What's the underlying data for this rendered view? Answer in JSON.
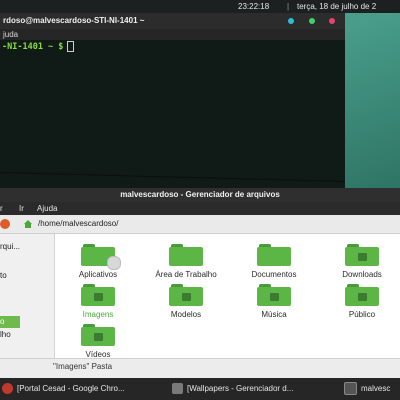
{
  "top_panel": {
    "clock": "23:22:18",
    "separator": "|",
    "date": "terça, 18 de julho de 2"
  },
  "terminal": {
    "title": "rdoso@malvescardoso-STI-NI-1401 ~",
    "menu": "juda",
    "prompt": "-NI-1401 ~ $"
  },
  "file_manager": {
    "title": "malvescardoso - Gerenciador de arquivos",
    "menu": [
      "r",
      "Ir",
      "Ajuda"
    ],
    "path": "/home/malvescardoso/",
    "sidebar": [
      "rqui...",
      "to",
      "lho"
    ],
    "sidebar_selected": "o",
    "files": [
      {
        "label": "Aplicativos",
        "icon": "gear-folder-icon"
      },
      {
        "label": "Área de Trabalho",
        "icon": "folder-icon"
      },
      {
        "label": "Documentos",
        "icon": "folder-icon"
      },
      {
        "label": "Downloads",
        "icon": "download-folder-icon"
      },
      {
        "label": "Imagens",
        "icon": "image-folder-icon",
        "selected": true
      },
      {
        "label": "Modelos",
        "icon": "folder-icon"
      },
      {
        "label": "Música",
        "icon": "music-folder-icon"
      },
      {
        "label": "Público",
        "icon": "user-folder-icon"
      },
      {
        "label": "Vídeos",
        "icon": "video-folder-icon"
      }
    ],
    "status": "\"Imagens\" Pasta"
  },
  "taskbar": {
    "tasks": [
      {
        "label": "[Portal Cesad - Google Chro..."
      },
      {
        "label": "[Wallpapers - Gerenciador d..."
      },
      {
        "label": "malvesc"
      }
    ]
  }
}
